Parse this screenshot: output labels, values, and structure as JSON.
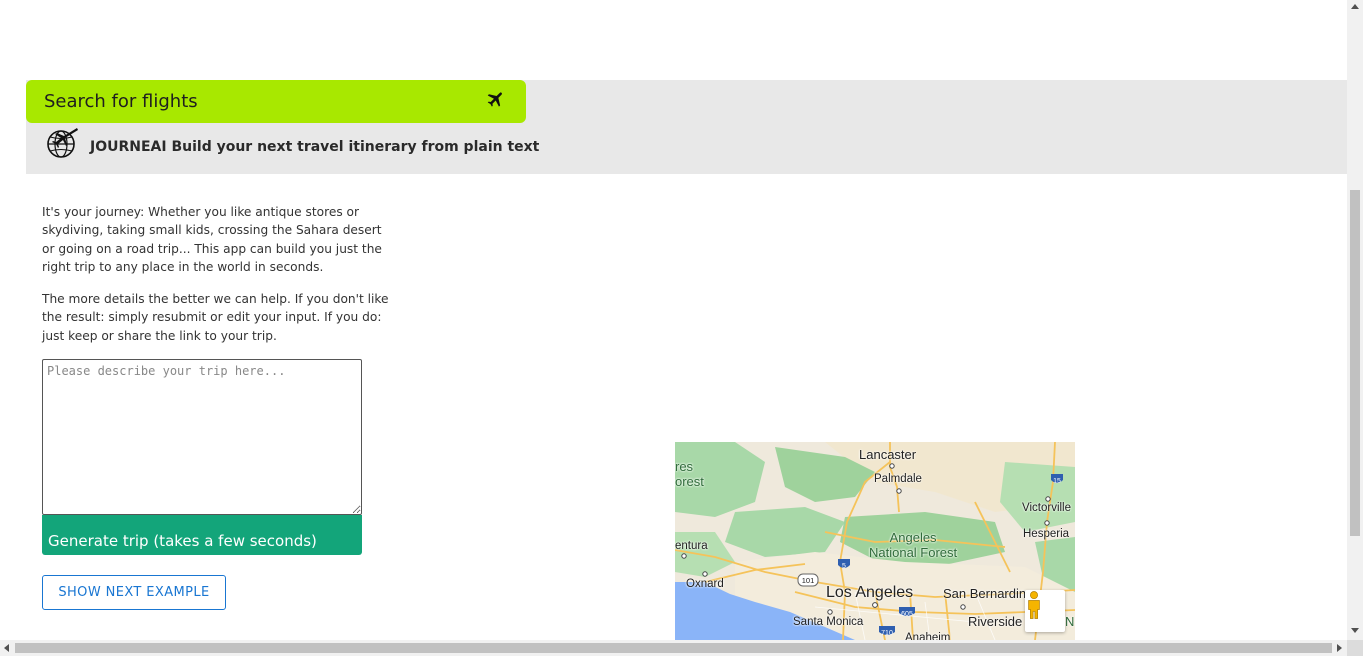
{
  "header": {
    "flights_banner": {
      "label": "Search for flights",
      "icon": "airplane-icon",
      "background": "#a8e800"
    },
    "brand": {
      "logo_icon": "globe-airplane-icon",
      "title": "JOURNEAI Build your next travel itinerary from plain text"
    }
  },
  "intro": {
    "paragraph_1": "It's your journey: Whether you like antique stores or skydiving, taking small kids, crossing the Sahara desert or going on a road trip... This app can build you just the right trip to any place in the world in seconds.",
    "paragraph_2": "The more details the better we can help. If you don't like the result: simply resubmit or edit your input. If you do: just keep or share the link to your trip."
  },
  "form": {
    "trip_input": {
      "value": "",
      "placeholder": "Please describe your trip here..."
    },
    "generate_label": "Generate trip (takes a few seconds)",
    "generate_color": "#13a57a",
    "next_example_label": "SHOW NEXT EXAMPLE",
    "next_example_color": "#1976d2"
  },
  "map": {
    "labels": {
      "lancaster": "Lancaster",
      "palmdale": "Palmdale",
      "victorville": "Victorville",
      "hesperia": "Hesperia",
      "forest_left_1": "res",
      "forest_left_2": "orest",
      "ventura": "entura",
      "oxnard": "Oxnard",
      "angeles_nf_1": "Angeles",
      "angeles_nf_2": "National Forest",
      "los_angeles": "Los Angeles",
      "san_bernardino": "San Bernardino",
      "santa_monica": "Santa Monica",
      "riverside": "Riverside",
      "anaheim": "Anaheim",
      "edge_n": "N"
    },
    "shields": {
      "i5": "5",
      "i15": "15",
      "i605": "605",
      "i710": "710",
      "us101": "101"
    },
    "pegman_icon": "street-view-pegman-icon"
  }
}
